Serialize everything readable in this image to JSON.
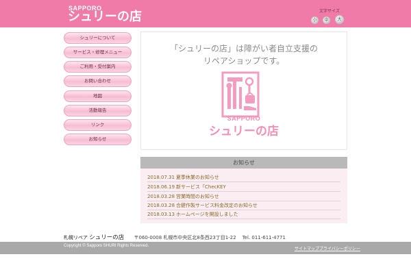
{
  "header": {
    "logo_sub": "SAPPORO",
    "logo_main": "シュリーの店",
    "util_label": "文字サイズ",
    "font_size_buttons": [
      "小",
      "中",
      "大"
    ]
  },
  "nav": {
    "items": [
      {
        "label": "シュリーについて"
      },
      {
        "label": "サービス・修理メニュー"
      },
      {
        "label": "ご利用・受付案内"
      },
      {
        "label": "お問い合わせ"
      },
      {
        "label": "地図"
      },
      {
        "label": "活動報告"
      },
      {
        "label": "リンク"
      },
      {
        "label": "お知らせ"
      }
    ]
  },
  "hero": {
    "line1": "「シュリーの店」は障がい者自立支援の",
    "line2": "リペアショップです。",
    "brand_sub": "SAPPORO",
    "brand_main": "シュリーの店",
    "emblem_icon": "repair-tools-emblem-icon"
  },
  "news": {
    "title": "お知らせ",
    "items": [
      {
        "date": "2018.07.31",
        "text": "夏季休業のお知らせ"
      },
      {
        "date": "2018.06.19",
        "text": "新サービス「ChecKEY"
      },
      {
        "date": "2018.03.28",
        "text": "営業時間のお知らせ"
      },
      {
        "date": "2018.03.28",
        "text": "合鍵作製サービス料金改定のお知らせ"
      },
      {
        "date": "2018.03.13",
        "text": "ホームページを開設しました"
      }
    ]
  },
  "footer": {
    "org_small": "札幌リペア",
    "org_name": "シュリーの店",
    "address": "〒060-0008 札幌市中央区北8条西23丁目1-22",
    "tel": "Tel. 011-611-4771",
    "copyright": "Copyright © Sapporo SHURI Rights Reserved.",
    "links": [
      "サイトマップ",
      "プライバシーポリシー"
    ]
  },
  "colors": {
    "brand_pink": "#f07aa8",
    "nav_pink": "#f7bcd3",
    "footer_gray": "#a9a9a9",
    "news_bg": "#fbeef3"
  }
}
